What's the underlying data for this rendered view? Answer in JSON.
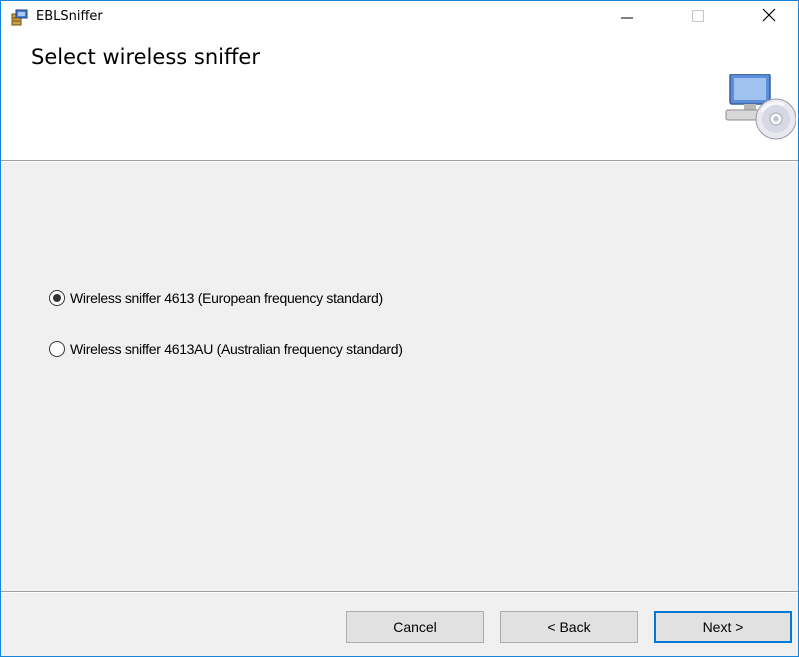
{
  "window": {
    "title": "EBLSniffer",
    "controls": {
      "minimize_icon": "minimize-icon",
      "maximize_icon": "maximize-icon",
      "close_icon": "close-icon"
    }
  },
  "banner": {
    "title": "Select wireless sniffer",
    "icon": "computer-cd-icon"
  },
  "options": [
    {
      "label": "Wireless sniffer 4613 (European frequency standard)",
      "selected": true
    },
    {
      "label": "Wireless sniffer 4613AU (Australian frequency standard)",
      "selected": false
    }
  ],
  "buttons": {
    "cancel": "Cancel",
    "back": "< Back",
    "next": "Next >"
  },
  "colors": {
    "accent": "#0078d7",
    "window_border": "#1883d7",
    "body_bg": "#f0f0f0"
  }
}
